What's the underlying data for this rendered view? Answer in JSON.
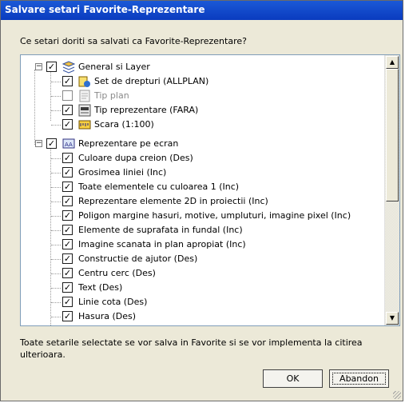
{
  "window": {
    "title": "Salvare setari Favorite-Reprezentare"
  },
  "prompt": "Ce setari doriti sa salvati ca Favorite-Reprezentare?",
  "tree": {
    "groups": [
      {
        "label": "General si Layer",
        "icon": "general-layer-icon",
        "expanded": true,
        "checked": true,
        "children": [
          {
            "label": "Set de drepturi (ALLPLAN)",
            "icon": "rights-set-icon",
            "checked": true,
            "enabled": true
          },
          {
            "label": "Tip plan",
            "icon": "plan-type-icon",
            "checked": false,
            "enabled": false
          },
          {
            "label": "Tip reprezentare (FARA)",
            "icon": "representation-type-icon",
            "checked": true,
            "enabled": true
          },
          {
            "label": "Scara (1:100)",
            "icon": "scale-icon",
            "checked": true,
            "enabled": true
          }
        ]
      },
      {
        "label": "Reprezentare pe ecran",
        "icon": "screen-representation-icon",
        "expanded": true,
        "checked": true,
        "children": [
          {
            "label": "Culoare dupa creion (Des)",
            "checked": true
          },
          {
            "label": "Grosimea liniei (Inc)",
            "checked": true
          },
          {
            "label": "Toate elementele cu culoarea 1 (Inc)",
            "checked": true
          },
          {
            "label": "Reprezentare elemente 2D in proiectii (Inc)",
            "checked": true
          },
          {
            "label": "Poligon margine hasuri, motive, umpluturi, imagine pixel (Inc)",
            "checked": true
          },
          {
            "label": "Elemente de suprafata in fundal (Inc)",
            "checked": true
          },
          {
            "label": "Imagine scanata in plan apropiat (Inc)",
            "checked": true
          },
          {
            "label": "Constructie de ajutor (Des)",
            "checked": true
          },
          {
            "label": "Centru cerc (Des)",
            "checked": true
          },
          {
            "label": "Text (Des)",
            "checked": true
          },
          {
            "label": "Linie cota (Des)",
            "checked": true
          },
          {
            "label": "Hasura (Des)",
            "checked": true
          }
        ]
      }
    ]
  },
  "checkmark": "✓",
  "expander": "−",
  "scrollbar": {
    "up_arrow": "▲",
    "down_arrow": "▼"
  },
  "note": "Toate setarile selectate se vor salva in Favorite si se vor implementa la citirea ulterioara.",
  "buttons": {
    "ok": "OK",
    "cancel": "Abandon"
  },
  "colors": {
    "title_bar": "#0a3bbf",
    "dialog_bg": "#ece9d8",
    "field_border": "#7f9db9"
  }
}
